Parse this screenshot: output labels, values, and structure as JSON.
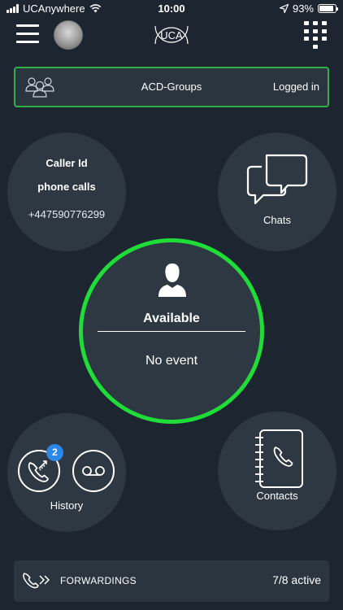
{
  "status_bar": {
    "carrier": "UCAnywhere",
    "time": "10:00",
    "battery": "93%"
  },
  "header": {
    "logo_text": "UCA",
    "menu_icon": "hamburger-icon",
    "dialpad_icon": "dialpad-icon"
  },
  "acd": {
    "title": "ACD-Groups",
    "status": "Logged in",
    "icon": "group-icon"
  },
  "caller_id": {
    "title": "Caller Id",
    "subtitle": "phone calls",
    "number": "+447590776299"
  },
  "chats": {
    "label": "Chats",
    "icon": "chat-bubbles-icon"
  },
  "presence": {
    "state": "Available",
    "event": "No event",
    "ring_color": "#1fdc38"
  },
  "history": {
    "label": "History",
    "badge_count": "2",
    "calls_icon": "call-history-icon",
    "voicemail_icon": "voicemail-icon"
  },
  "contacts": {
    "label": "Contacts",
    "icon": "address-book-icon"
  },
  "forwardings": {
    "title": "FORWARDINGS",
    "value": "7/8 active",
    "icon": "call-forward-icon"
  },
  "colors": {
    "background": "#1c2530",
    "tile": "#2e3842",
    "accent_green": "#1fdc38",
    "badge_blue": "#2b88e6"
  }
}
